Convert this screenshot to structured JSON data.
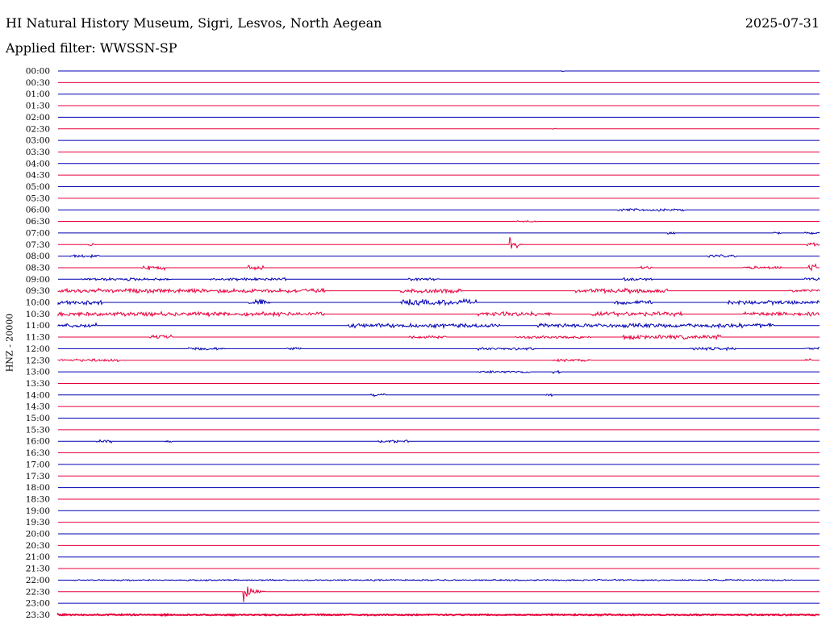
{
  "header": {
    "station": "HI Natural History Museum, Sigri, Lesvos, North Aegean",
    "date": "2025-07-31",
    "filter": "Applied filter: WWSSN-SP"
  },
  "channel_label": "HNZ - 20000",
  "colors": {
    "even_row": "#0000b4",
    "odd_row": "#e8003c",
    "background": "#ffffff"
  },
  "chart_data": {
    "type": "line",
    "xlabel": "",
    "ylabel": "HNZ - 20000",
    "grid": false,
    "legend": "none",
    "row_labels": [
      "00:00",
      "00:30",
      "01:00",
      "01:30",
      "02:00",
      "02:30",
      "03:00",
      "03:30",
      "04:00",
      "04:30",
      "05:00",
      "05:30",
      "06:00",
      "06:30",
      "07:00",
      "07:30",
      "08:00",
      "08:30",
      "09:00",
      "09:30",
      "10:00",
      "10:30",
      "11:00",
      "11:30",
      "12:00",
      "12:30",
      "13:00",
      "13:30",
      "14:00",
      "14:30",
      "15:00",
      "15:30",
      "16:00",
      "16:30",
      "17:00",
      "17:30",
      "18:00",
      "18:30",
      "19:00",
      "19:30",
      "20:00",
      "20:30",
      "21:00",
      "21:30",
      "22:00",
      "22:30",
      "23:00",
      "23:30"
    ],
    "row_duration_minutes": 30,
    "trace_activity": [
      {
        "row": "00:00",
        "bursts": [
          [
            0.66,
            0.005,
            1
          ]
        ]
      },
      {
        "row": "02:30",
        "bursts": [
          [
            0.65,
            0.004,
            1
          ]
        ]
      },
      {
        "row": "06:00",
        "bursts": [
          [
            0.735,
            0.09,
            2
          ]
        ]
      },
      {
        "row": "06:30",
        "bursts": [
          [
            0.6,
            0.03,
            1
          ]
        ]
      },
      {
        "row": "07:00",
        "bursts": [
          [
            0.8,
            0.01,
            2
          ],
          [
            0.94,
            0.01,
            2
          ],
          [
            0.98,
            0.02,
            2
          ]
        ]
      },
      {
        "row": "07:30",
        "bursts": [
          [
            0.593,
            0.008,
            13
          ],
          [
            0.6,
            0.01,
            10
          ],
          [
            0.983,
            0.02,
            3
          ],
          [
            0.04,
            0.01,
            2
          ]
        ]
      },
      {
        "row": "08:00",
        "bursts": [
          [
            0.015,
            0.04,
            2
          ],
          [
            0.85,
            0.04,
            2
          ]
        ]
      },
      {
        "row": "08:30",
        "bursts": [
          [
            0.11,
            0.03,
            3
          ],
          [
            0.25,
            0.02,
            3
          ],
          [
            0.76,
            0.02,
            2
          ],
          [
            0.9,
            0.05,
            2
          ],
          [
            0.985,
            0.01,
            5
          ]
        ]
      },
      {
        "row": "09:00",
        "bursts": [
          [
            0.03,
            0.12,
            2
          ],
          [
            0.2,
            0.1,
            2
          ],
          [
            0.46,
            0.04,
            2
          ],
          [
            0.74,
            0.04,
            2
          ],
          [
            0.98,
            0.02,
            2
          ]
        ]
      },
      {
        "row": "09:30",
        "bursts": [
          [
            0.0,
            0.35,
            3
          ],
          [
            0.45,
            0.08,
            3
          ],
          [
            0.68,
            0.12,
            3
          ],
          [
            0.96,
            0.04,
            2
          ]
        ]
      },
      {
        "row": "10:00",
        "bursts": [
          [
            0.0,
            0.06,
            3
          ],
          [
            0.25,
            0.03,
            4
          ],
          [
            0.45,
            0.1,
            4
          ],
          [
            0.73,
            0.05,
            3
          ],
          [
            0.88,
            0.12,
            3
          ]
        ]
      },
      {
        "row": "10:30",
        "bursts": [
          [
            0.0,
            0.35,
            3
          ],
          [
            0.55,
            0.1,
            3
          ],
          [
            0.7,
            0.12,
            3
          ],
          [
            0.9,
            0.1,
            3
          ]
        ]
      },
      {
        "row": "11:00",
        "bursts": [
          [
            0.0,
            0.05,
            3
          ],
          [
            0.38,
            0.2,
            3
          ],
          [
            0.63,
            0.2,
            3
          ],
          [
            0.82,
            0.12,
            3
          ]
        ]
      },
      {
        "row": "11:30",
        "bursts": [
          [
            0.12,
            0.03,
            3
          ],
          [
            0.46,
            0.05,
            2
          ],
          [
            0.6,
            0.1,
            2
          ],
          [
            0.74,
            0.13,
            3
          ]
        ]
      },
      {
        "row": "12:00",
        "bursts": [
          [
            0.17,
            0.05,
            2
          ],
          [
            0.3,
            0.02,
            2
          ],
          [
            0.55,
            0.08,
            2
          ],
          [
            0.83,
            0.06,
            2
          ],
          [
            0.98,
            0.02,
            2
          ]
        ]
      },
      {
        "row": "12:30",
        "bursts": [
          [
            0.0,
            0.08,
            2
          ],
          [
            0.65,
            0.05,
            2
          ],
          [
            0.98,
            0.01,
            2
          ]
        ]
      },
      {
        "row": "13:00",
        "bursts": [
          [
            0.55,
            0.07,
            2
          ],
          [
            0.65,
            0.01,
            2
          ]
        ]
      },
      {
        "row": "14:00",
        "bursts": [
          [
            0.41,
            0.02,
            2
          ],
          [
            0.64,
            0.01,
            2
          ]
        ]
      },
      {
        "row": "16:00",
        "bursts": [
          [
            0.05,
            0.02,
            2
          ],
          [
            0.14,
            0.01,
            2
          ],
          [
            0.42,
            0.04,
            2
          ]
        ]
      },
      {
        "row": "22:00",
        "bursts": [
          [
            0.017,
            0.95,
            1
          ]
        ]
      },
      {
        "row": "22:30",
        "bursts": [
          [
            0.243,
            0.03,
            14
          ]
        ]
      },
      {
        "row": "23:30",
        "bursts": [
          [
            0.0,
            1.0,
            1
          ]
        ]
      }
    ]
  }
}
